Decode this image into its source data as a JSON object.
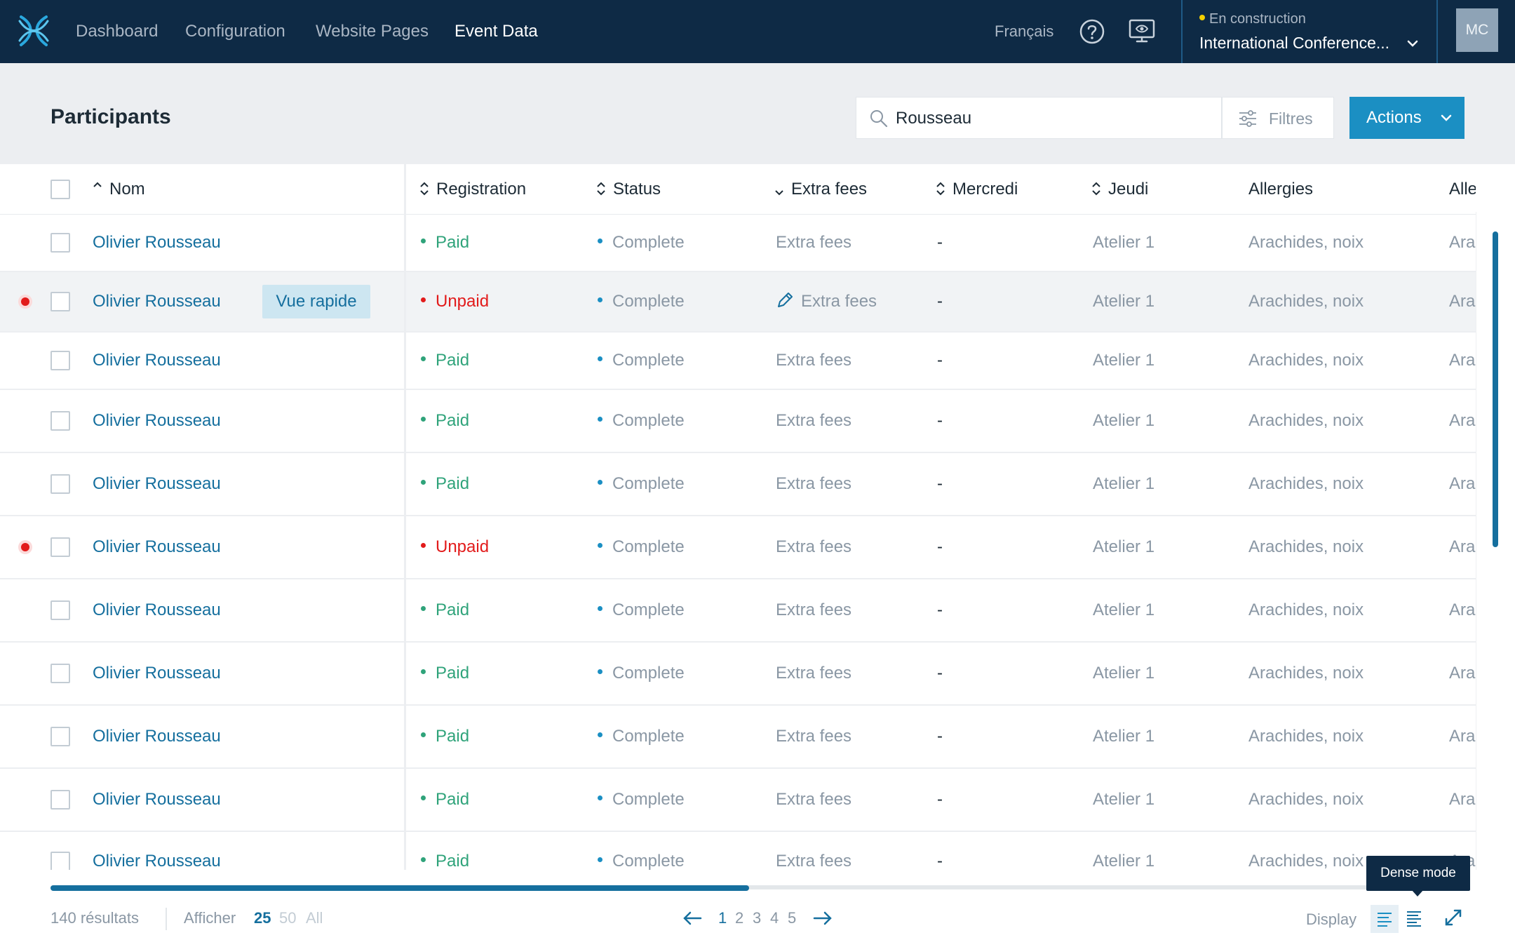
{
  "nav": {
    "links": [
      "Dashboard",
      "Configuration",
      "Website Pages",
      "Event Data"
    ],
    "active": "Event Data",
    "language": "Français",
    "event_status": "En construction",
    "event_name": "International Conference...",
    "avatar_initials": "MC"
  },
  "header": {
    "title": "Participants",
    "search_value": "Rousseau",
    "filters_label": "Filtres",
    "actions_label": "Actions"
  },
  "table": {
    "columns": {
      "name": "Nom",
      "registration": "Registration",
      "status": "Status",
      "extra_fees": "Extra fees",
      "mercredi": "Mercredi",
      "jeudi": "Jeudi",
      "allergies": "Allergies",
      "allergies2": "Allergies"
    },
    "quick_view_label": "Vue rapide",
    "rows": [
      {
        "name": "Olivier Rousseau",
        "registration": "Paid",
        "status": "Complete",
        "extra_fees": "Extra fees",
        "mercredi": "-",
        "jeudi": "Atelier 1",
        "allergies": "Arachides, noix",
        "allergies2": "Ara"
      },
      {
        "name": "Olivier Rousseau",
        "registration": "Unpaid",
        "status": "Complete",
        "extra_fees": "Extra fees",
        "mercredi": "-",
        "jeudi": "Atelier 1",
        "allergies": "Arachides, noix",
        "allergies2": "Ara"
      },
      {
        "name": "Olivier Rousseau",
        "registration": "Paid",
        "status": "Complete",
        "extra_fees": "Extra fees",
        "mercredi": "-",
        "jeudi": "Atelier 1",
        "allergies": "Arachides, noix",
        "allergies2": "Ara"
      },
      {
        "name": "Olivier Rousseau",
        "registration": "Paid",
        "status": "Complete",
        "extra_fees": "Extra fees",
        "mercredi": "-",
        "jeudi": "Atelier 1",
        "allergies": "Arachides, noix",
        "allergies2": "Ara"
      },
      {
        "name": "Olivier Rousseau",
        "registration": "Paid",
        "status": "Complete",
        "extra_fees": "Extra fees",
        "mercredi": "-",
        "jeudi": "Atelier 1",
        "allergies": "Arachides, noix",
        "allergies2": "Ara"
      },
      {
        "name": "Olivier Rousseau",
        "registration": "Unpaid",
        "status": "Complete",
        "extra_fees": "Extra fees",
        "mercredi": "-",
        "jeudi": "Atelier 1",
        "allergies": "Arachides, noix",
        "allergies2": "Ara"
      },
      {
        "name": "Olivier Rousseau",
        "registration": "Paid",
        "status": "Complete",
        "extra_fees": "Extra fees",
        "mercredi": "-",
        "jeudi": "Atelier 1",
        "allergies": "Arachides, noix",
        "allergies2": "Ara"
      },
      {
        "name": "Olivier Rousseau",
        "registration": "Paid",
        "status": "Complete",
        "extra_fees": "Extra fees",
        "mercredi": "-",
        "jeudi": "Atelier 1",
        "allergies": "Arachides, noix",
        "allergies2": "Ara"
      },
      {
        "name": "Olivier Rousseau",
        "registration": "Paid",
        "status": "Complete",
        "extra_fees": "Extra fees",
        "mercredi": "-",
        "jeudi": "Atelier 1",
        "allergies": "Arachides, noix",
        "allergies2": "Ara"
      },
      {
        "name": "Olivier Rousseau",
        "registration": "Paid",
        "status": "Complete",
        "extra_fees": "Extra fees",
        "mercredi": "-",
        "jeudi": "Atelier 1",
        "allergies": "Arachides, noix",
        "allergies2": "Ara"
      },
      {
        "name": "Olivier Rousseau",
        "registration": "Paid",
        "status": "Complete",
        "extra_fees": "Extra fees",
        "mercredi": "-",
        "jeudi": "Atelier 1",
        "allergies": "Arachides, noix",
        "allergies2": "Ara"
      }
    ]
  },
  "footer": {
    "results": "140 résultats",
    "show_label": "Afficher",
    "per_page": [
      "25",
      "50",
      "All"
    ],
    "pages": [
      "1",
      "2",
      "3",
      "4",
      "5"
    ],
    "current_page": "1",
    "display_label": "Display",
    "tooltip": "Dense mode"
  },
  "icons": {
    "logo": "logo-icon",
    "help": "help-icon",
    "preview": "preview-icon",
    "search": "search-icon",
    "filter": "filter-icon",
    "sort": "sort-icon",
    "edit": "pencil-icon",
    "prev": "arrow-left-icon",
    "next": "arrow-right-icon",
    "expand": "expand-icon"
  },
  "colors": {
    "nav_bg": "#0e2a45",
    "accent": "#1b8fc3",
    "link": "#156f9e",
    "paid": "#2fa37a",
    "unpaid": "#e21b1b",
    "status_dot": "#1b8fc3"
  }
}
